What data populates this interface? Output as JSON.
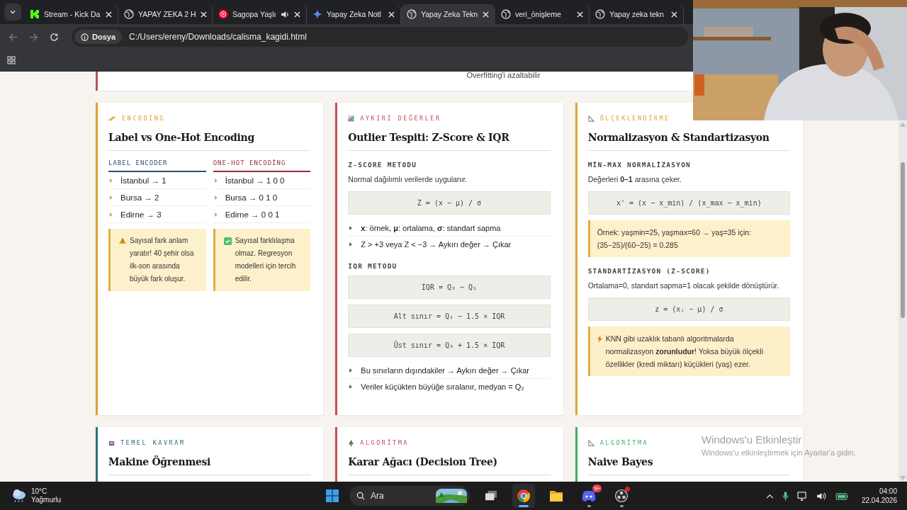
{
  "browser": {
    "tabs": [
      {
        "title": "Stream - Kick Da",
        "selected": false,
        "audio": false
      },
      {
        "title": "YAPAY ZEKA 2 H",
        "selected": false,
        "audio": false
      },
      {
        "title": "Sagopa Yaşlı",
        "selected": false,
        "audio": true
      },
      {
        "title": "Yapay Zeka Notl",
        "selected": false,
        "audio": false
      },
      {
        "title": "Yapay Zeka Tekn",
        "selected": true,
        "audio": false
      },
      {
        "title": "veri_önişleme",
        "selected": false,
        "audio": false
      },
      {
        "title": "Yapay zeka tekn",
        "selected": false,
        "audio": false
      }
    ],
    "address": {
      "scheme_label": "Dosya",
      "url": "C:/Users/ereny/Downloads/calisma_kagidi.html"
    }
  },
  "page": {
    "cut_note": "Overfitting'i azaltabilir",
    "cards": [
      {
        "tag": "ENCODİNG",
        "color": "#e0a030",
        "title": "Label vs One-Hot Encoding",
        "blocks": [
          {
            "kind": "columns",
            "columns": [
              {
                "heading": "LABEL ENCODER",
                "color": "#2f5070",
                "items": [
                  "İstanbul → 1",
                  "Bursa → 2",
                  "Edirne → 3"
                ],
                "note": {
                  "kind": "warning",
                  "text": "Sayısal fark anlam yaratır! 40 şehir olsa ilk-son arasında büyük fark oluşur."
                }
              },
              {
                "heading": "ONE-HOT ENCODİNG",
                "color": "#9b2c3c",
                "items": [
                  "İstanbul → 1 0 0",
                  "Bursa → 0 1 0",
                  "Edirne → 0 0 1"
                ],
                "note": {
                  "kind": "success",
                  "text": "Sayısal farklılaşma olmaz. Regresyon modelleri için tercih edilir."
                }
              }
            ]
          }
        ]
      },
      {
        "tag": "AYKIRI DEĞERLER",
        "color": "#c0505a",
        "title": "Outlier Tespiti: Z-Score & IQR",
        "blocks": [
          {
            "kind": "heading",
            "text": "Z-SCORE METODU"
          },
          {
            "kind": "text",
            "text": "Normal dağılımlı verilerde uygulanır."
          },
          {
            "kind": "formula",
            "text": "Z = (x − μ) / σ"
          },
          {
            "kind": "bullets",
            "items": [
              "**x**: örnek, **μ**: ortalama, **σ**: standart sapma",
              "Z > +3 veya Z < −3 → Aykırı değer → Çıkar"
            ]
          },
          {
            "kind": "heading",
            "text": "IQR METODU"
          },
          {
            "kind": "formula",
            "text": "IQR = Q₃ − Q₁"
          },
          {
            "kind": "formula",
            "text": "Alt sınır = Q₁ − 1.5 × IQR"
          },
          {
            "kind": "formula",
            "text": "Üst sınır = Q₃ + 1.5 × IQR"
          },
          {
            "kind": "bullets",
            "items": [
              "Bu sınırların dışındakiler → Aykırı değer → Çıkar",
              "Veriler küçükten büyüğe sıralanır, medyan = Q₂"
            ]
          }
        ]
      },
      {
        "tag": "ÖLÇEKLENDİRME",
        "color": "#d8a838",
        "title": "Normalizasyon & Standartizasyon",
        "blocks": [
          {
            "kind": "heading",
            "text": "MİN-MAX NORMALİZASYON"
          },
          {
            "kind": "text",
            "text": "Değerleri **0–1** arasına çeker."
          },
          {
            "kind": "formula",
            "text": "x' = (x − x_min) / (x_max − x_min)"
          },
          {
            "kind": "note",
            "note": {
              "kind": "plain",
              "text": "Örnek: yaşmin=25, yaşmax=60 → yaş=35 için: (35−25)/(60−25) = 0.285"
            }
          },
          {
            "kind": "heading",
            "text": "STANDARTİZASYON (Z-SCORE)"
          },
          {
            "kind": "text",
            "text": "Ortalama=0, standart sapma=1 olacak şekilde dönüştürür."
          },
          {
            "kind": "formula",
            "text": "z = (xᵢ − μ) / σ"
          },
          {
            "kind": "note",
            "note": {
              "kind": "tip",
              "text": "KNN gibi uzaklık tabanlı algoritmalarda normalizasyon **zorunludur**! Yoksa büyük ölçekli özellikler (kredi miktarı) küçükleri (yaş) ezer."
            }
          }
        ]
      },
      {
        "tag": "TEMEL KAVRAM",
        "color": "#2a6f80",
        "title": "Makine Öğrenmesi"
      },
      {
        "tag": "ALGORİTMA",
        "color": "#c0505a",
        "title": "Karar Ağacı (Decision Tree)"
      },
      {
        "tag": "ALGORİTMA",
        "color": "#3fae5c",
        "title": "Naive Bayes"
      }
    ]
  },
  "activation": {
    "title": "Windows'u Etkinleştir",
    "subtitle": "Windows'u etkinleştirmek için Ayarlar'a gidin."
  },
  "taskbar": {
    "weather": {
      "temperature": "10°C",
      "condition": "Yağmurlu"
    },
    "search": {
      "placeholder": "Ara"
    },
    "apps": [
      {
        "active": false,
        "running": false
      },
      {
        "active": true,
        "running": true
      },
      {
        "active": false,
        "running": false
      },
      {
        "active": false,
        "running": true,
        "badge": "9+"
      },
      {
        "active": false,
        "running": true,
        "alert": true
      }
    ],
    "clock": {
      "time": "04:00",
      "date": "22.04.2026"
    }
  }
}
